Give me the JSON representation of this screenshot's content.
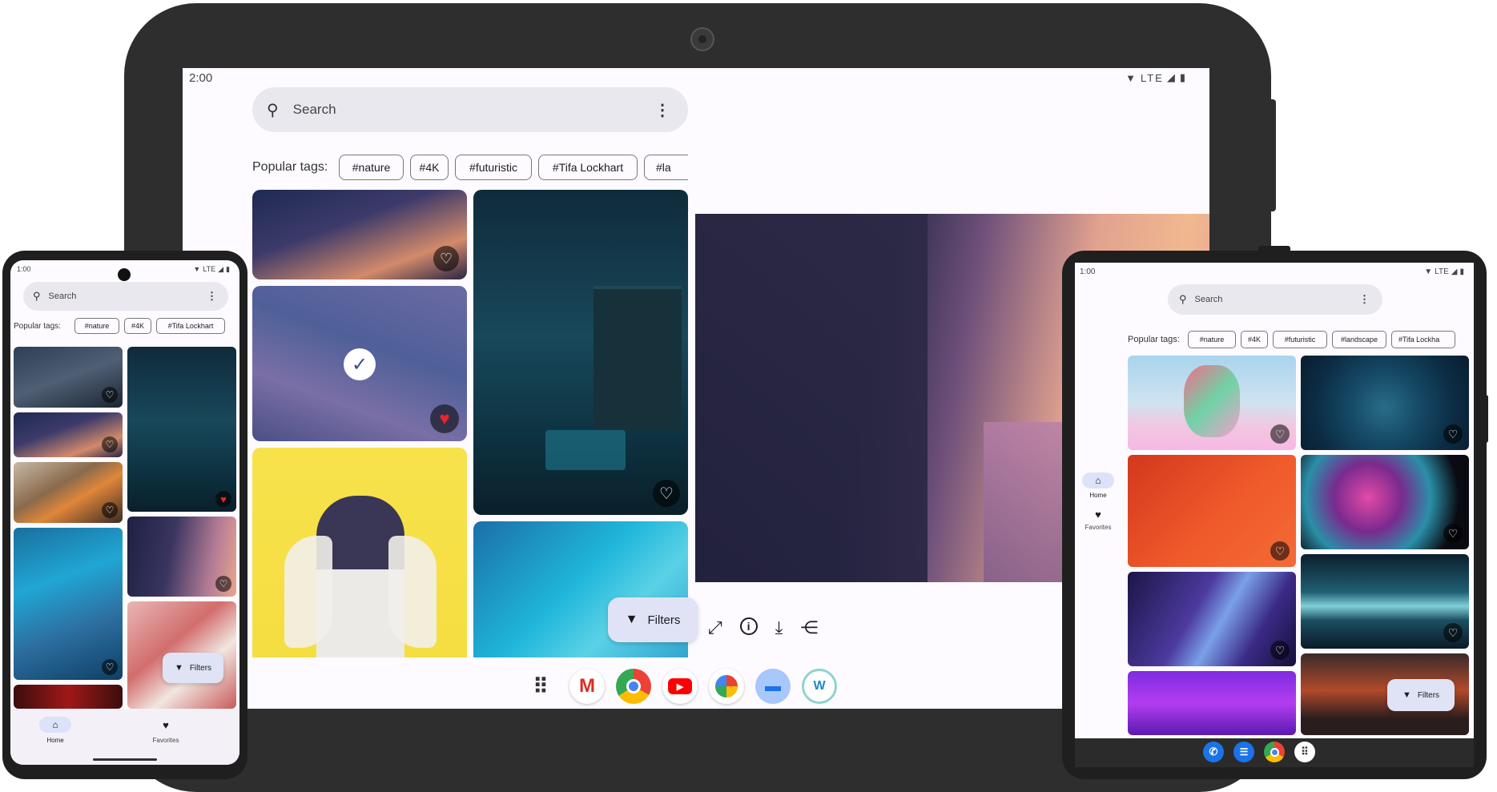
{
  "big": {
    "time": "2:00",
    "status": "LTE",
    "search_placeholder": "Search",
    "tags_label": "Popular tags:",
    "tags": [
      "#nature",
      "#4K",
      "#futuristic",
      "#Tifa Lockhart",
      "#la"
    ],
    "filters_label": "Filters",
    "detail_actions": [
      "fullscreen-icon",
      "info-icon",
      "download-icon",
      "share-icon"
    ],
    "dock_apps": [
      "apps-grid",
      "gmail",
      "chrome",
      "youtube",
      "photos",
      "files",
      "wallpaper-app"
    ]
  },
  "phone": {
    "time": "1:00",
    "status": "LTE",
    "search_placeholder": "Search",
    "tags_label": "Popular tags:",
    "tags": [
      "#nature",
      "#4K",
      "#Tifa Lockhart"
    ],
    "filters_label": "Filters",
    "nav": [
      {
        "label": "Home",
        "icon": "home-icon"
      },
      {
        "label": "Favorites",
        "icon": "heart-icon"
      }
    ]
  },
  "tablet": {
    "time": "1:00",
    "status": "LTE",
    "search_placeholder": "Search",
    "tags_label": "Popular tags:",
    "tags": [
      "#nature",
      "#4K",
      "#futuristic",
      "#landscape",
      "#Tifa Lockha"
    ],
    "filters_label": "Filters",
    "nav": [
      {
        "label": "Home",
        "icon": "home-icon"
      },
      {
        "label": "Favorites",
        "icon": "heart-icon"
      }
    ],
    "dock_apps": [
      "phone",
      "messages",
      "chrome",
      "apps-grid"
    ]
  },
  "colors": {
    "device_dark": "#2e2e2e",
    "screen_bg": "#fdfbff",
    "search_bg": "#eae8ef",
    "fab_bg": "#dfe3f5",
    "favorite_red": "#e8252a",
    "nav_active": "#dce2f9"
  }
}
